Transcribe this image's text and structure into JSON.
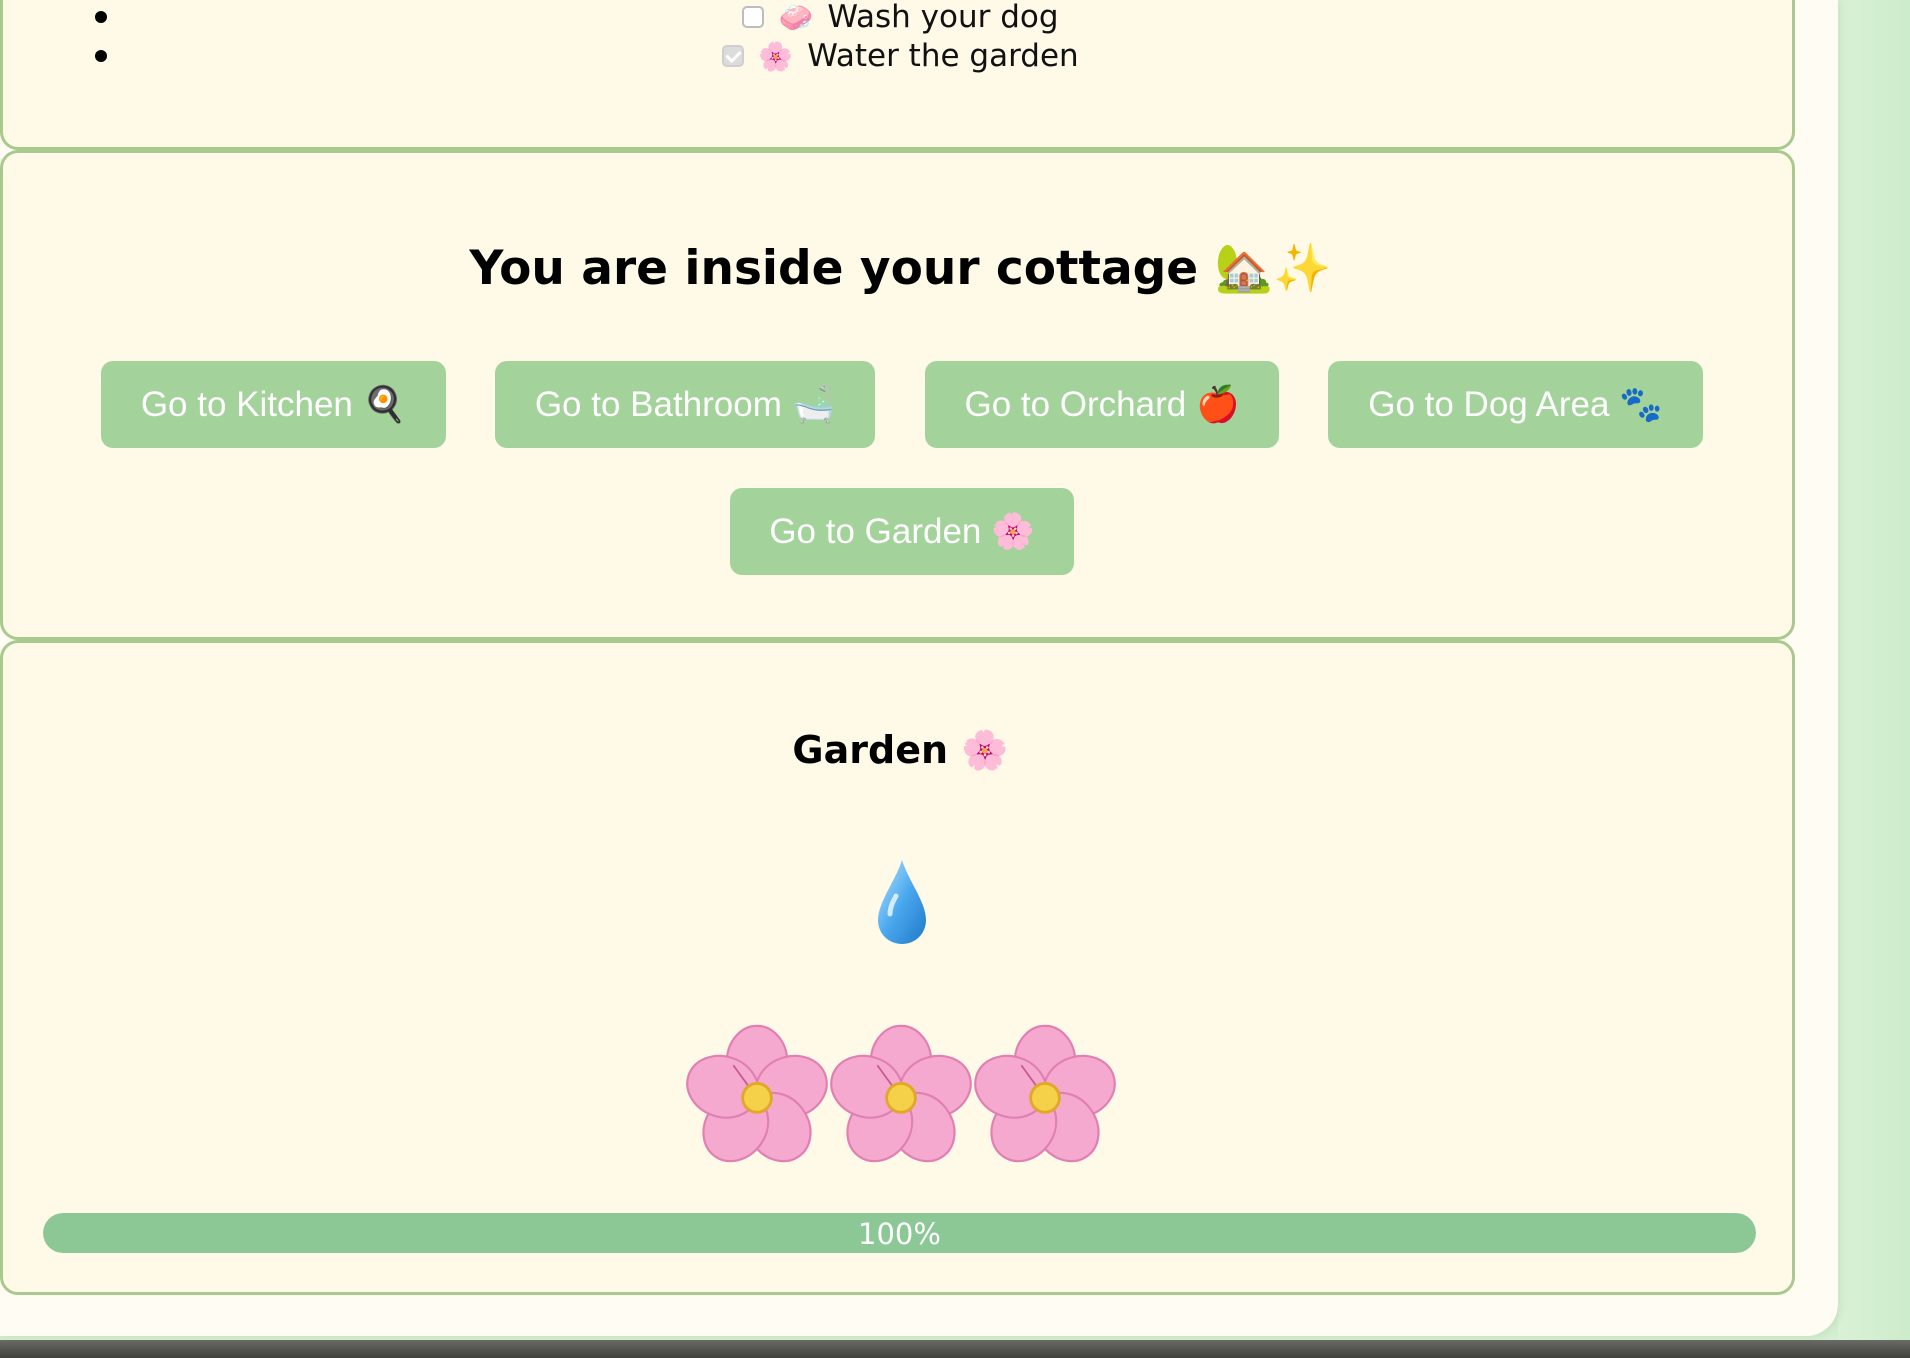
{
  "tasks": [
    {
      "emoji": "🧼",
      "label": "Wash your dog",
      "checked": false
    },
    {
      "emoji": "🌸",
      "label": "Water the garden",
      "checked": true
    }
  ],
  "house": {
    "title": "You are inside your cottage 🏡✨",
    "buttons": {
      "kitchen": "Go to Kitchen 🍳",
      "bathroom": "Go to Bathroom 🛁",
      "orchard": "Go to Orchard 🍎",
      "dog_area": "Go to Dog Area 🐾",
      "garden": "Go to Garden 🌸"
    }
  },
  "garden": {
    "title": "Garden 🌸",
    "icon": "water-drop-icon",
    "flower_icon": "cherry-blossom-icon",
    "flower_count": 3,
    "progress": 100,
    "progress_label": "100%"
  },
  "colors": {
    "button": "#a3d39b",
    "panel_border": "#a9c98f",
    "panel_bg": "#fff9e8",
    "progress": "#8cc896"
  }
}
